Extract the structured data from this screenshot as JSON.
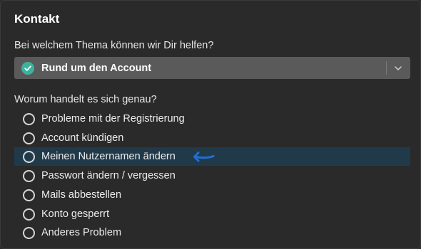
{
  "title": "Kontakt",
  "topic_question": "Bei welchem Thema können wir Dir helfen?",
  "topic_select": {
    "value": "Rund um den Account",
    "icon": "check-circle-icon"
  },
  "detail_question": "Worum handelt es sich genau?",
  "options": [
    {
      "label": "Probleme mit der Registrierung"
    },
    {
      "label": "Account kündigen"
    },
    {
      "label": "Meinen Nutzernamen ändern"
    },
    {
      "label": "Passwort ändern / vergessen"
    },
    {
      "label": "Mails abbestellen"
    },
    {
      "label": "Konto gesperrt"
    },
    {
      "label": "Anderes Problem"
    }
  ],
  "colors": {
    "accent": "#3cb39a",
    "highlight_row": "#213a4a",
    "arrow": "#1e6fd9"
  }
}
